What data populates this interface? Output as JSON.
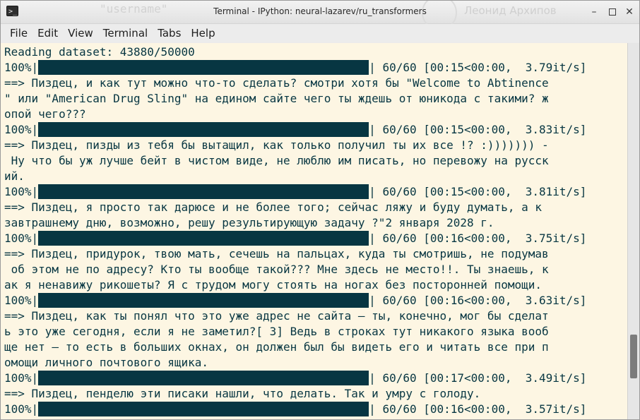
{
  "window": {
    "title": "Terminal - IPython: neural-lazarev/ru_transformers",
    "background_text": "\"username\"",
    "background_name": "Леонид Архипов",
    "icon_glyph": ">_",
    "min_glyph": "–",
    "close_glyph": "✕"
  },
  "menu": [
    "File",
    "Edit",
    "View",
    "Terminal",
    "Tabs",
    "Help"
  ],
  "colors": {
    "terminal_bg": "#fdf6e3",
    "terminal_fg": "#073642",
    "progress_bar": "#073642"
  },
  "terminal": {
    "header": "Reading dataset: 43880/50000",
    "blocks": [
      {
        "progress": {
          "pct": "100%|",
          "stats": "| 60/60 [00:15<00:00,  3.79it/s]"
        },
        "output": [
          "==> Пиздец, и как тут можно что-то сделать? смотри хотя бы \"Welcome to Abtinence",
          "\" или \"American Drug Sling\" на едином сайте чего ты ждешь от юникода с такими? ж",
          "опой чего???"
        ]
      },
      {
        "progress": {
          "pct": "100%|",
          "stats": "| 60/60 [00:15<00:00,  3.83it/s]"
        },
        "output": [
          "==> Пиздец, пизды из тебя бы вытащил, как только получил ты их все !? :))))))) -",
          " Ну что бы уж лучше бейт в чистом виде, не люблю им писать, но перевожу на русск",
          "ий."
        ]
      },
      {
        "progress": {
          "pct": "100%|",
          "stats": "| 60/60 [00:15<00:00,  3.81it/s]"
        },
        "output": [
          "==> Пиздец, я просто так дарюсе и не более того; сейчас ляжу и буду думать, а к",
          "завтрашнему дню, возможно, решу результирующую задачу ?\"2 января 2028 г."
        ]
      },
      {
        "progress": {
          "pct": "100%|",
          "stats": "| 60/60 [00:16<00:00,  3.75it/s]"
        },
        "output": [
          "==> Пиздец, придурок, твою мать, сечешь на пальцах, куда ты смотришь, не подумав",
          " об этом не по адресу? Кто ты вообще такой??? Мне здесь не место!!. Ты знаешь, к",
          "ак я ненавижу рикошеты? Я с трудом могу стоять на ногах без посторонней помощи."
        ]
      },
      {
        "progress": {
          "pct": "100%|",
          "stats": "| 60/60 [00:16<00:00,  3.63it/s]"
        },
        "output": [
          "==> Пиздец, как ты понял что это уже адрес не сайта — ты, конечно, мог бы сделат",
          "ь это уже сегодня, если я не заметил?[ 3] Ведь в строках тут никакого языка вооб",
          "ще нет — то есть в больших окнах, он должен был бы видеть его и читать все при п",
          "омощи личного почтового ящика."
        ]
      },
      {
        "progress": {
          "pct": "100%|",
          "stats": "| 60/60 [00:17<00:00,  3.49it/s]"
        },
        "output": [
          "==> Пиздец, пенделю эти писаки нашли, что делать. Так и умру с голоду."
        ]
      },
      {
        "progress": {
          "pct": "100%|",
          "stats": "| 60/60 [00:16<00:00,  3.57it/s]"
        },
        "output": []
      }
    ]
  },
  "scrollbar": {
    "position": 0.88,
    "visible_fraction": 0.12
  }
}
